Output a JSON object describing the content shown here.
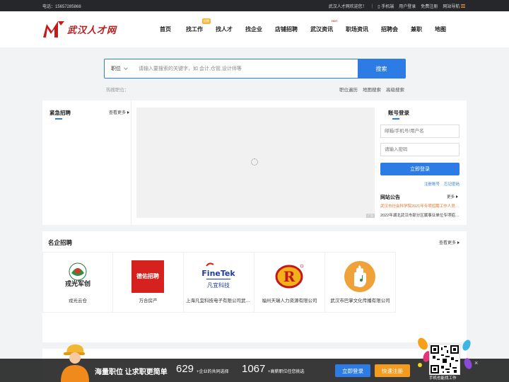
{
  "topbar": {
    "phone": "电话：15657285868",
    "welcome": "武汉人才网欢迎您！",
    "mobile": "手机端",
    "login": "用户登录",
    "register": "免费注册",
    "site_nav": "网站导航"
  },
  "header": {
    "logo_text": "武汉人才网",
    "nav": [
      {
        "label": "首页"
      },
      {
        "label": "找工作",
        "badge": "招聘"
      },
      {
        "label": "找人才"
      },
      {
        "label": "找企业"
      },
      {
        "label": "店铺招聘"
      },
      {
        "label": "武汉资讯",
        "badge": "HOT"
      },
      {
        "label": "职场资讯"
      },
      {
        "label": "招聘会"
      },
      {
        "label": "兼职"
      },
      {
        "label": "地图"
      }
    ]
  },
  "search": {
    "type_label": "职位",
    "placeholder": "请输入要搜索的关键字，如 会计,仓管,设计师等",
    "button": "搜索",
    "hot_label": "热搜职位：",
    "links": [
      "职位遍历",
      "地图搜索",
      "高级搜索"
    ]
  },
  "urgent": {
    "title": "紧急招聘",
    "more": "查看更多"
  },
  "banner": {
    "ad_label": "广告"
  },
  "login": {
    "title": "账号登录",
    "username_placeholder": "邮箱/手机号/用户名",
    "password_placeholder": "请输入密码",
    "button": "立即登录",
    "register_link": "注册账号",
    "forgot_link": "忘记密码"
  },
  "notice": {
    "title": "网站公告",
    "more": "更多",
    "items": [
      {
        "text": "武汉市社会科学院2021年专项招聘工作人员公告",
        "color": "#e8711f"
      },
      {
        "text": "2022年湖北武汉市部分区属事业单位专项招聘公告",
        "color": "#333333"
      }
    ]
  },
  "famous": {
    "title": "名企招聘",
    "more": "查看更多",
    "companies": [
      {
        "name": "戎光云仓",
        "logo_text": "戎光军创"
      },
      {
        "name": "万合房产",
        "logo_text": "德佑招聘"
      },
      {
        "name": "上海凡宜科技电子有限公司武汉分公司",
        "logo_text": "FineTek"
      },
      {
        "name": "福州天瑞人力资源有限公司",
        "logo_text": "R"
      },
      {
        "name": "武汉市巴掌文化传播有限公司",
        "logo_text": ""
      }
    ]
  },
  "footer_bar": {
    "slogan": "海量职位 让求职更简单",
    "count1": "629",
    "count1_label": "+企业的共同选择",
    "count2": "1067",
    "count2_label": "+高薪职位任您挑选",
    "login_button": "立即登录",
    "register_button": "快速注册",
    "qr_caption": "手机也能找工作",
    "close": "×"
  },
  "colors": {
    "accent": "#2d7be5",
    "topbar_bg": "#25272b",
    "logo_red": "#b51d1d",
    "orange_btn": "#f39b1f",
    "notice_orange": "#e8711f"
  }
}
